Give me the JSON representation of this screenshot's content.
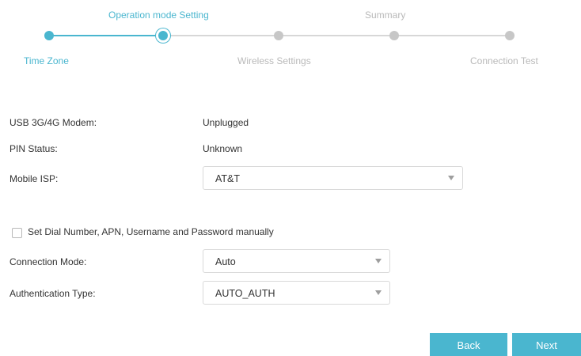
{
  "wizard": {
    "steps": [
      {
        "label": "Time Zone"
      },
      {
        "label": "Operation mode Setting"
      },
      {
        "label": "Wireless Settings"
      },
      {
        "label": "Summary"
      },
      {
        "label": "Connection Test"
      }
    ]
  },
  "status": {
    "usb_modem_label": "USB 3G/4G Modem:",
    "usb_modem_value": "Unplugged",
    "pin_status_label": "PIN Status:",
    "pin_status_value": "Unknown"
  },
  "form": {
    "mobile_isp_label": "Mobile ISP:",
    "mobile_isp_value": "AT&T",
    "manual_checkbox_label": "Set Dial Number, APN, Username and Password manually",
    "connection_mode_label": "Connection Mode:",
    "connection_mode_value": "Auto",
    "auth_type_label": "Authentication Type:",
    "auth_type_value": "AUTO_AUTH"
  },
  "actions": {
    "back_label": "Back",
    "next_label": "Next"
  },
  "colors": {
    "accent": "#4ab6cf",
    "inactive": "#c7c7c7",
    "text": "#333333"
  }
}
